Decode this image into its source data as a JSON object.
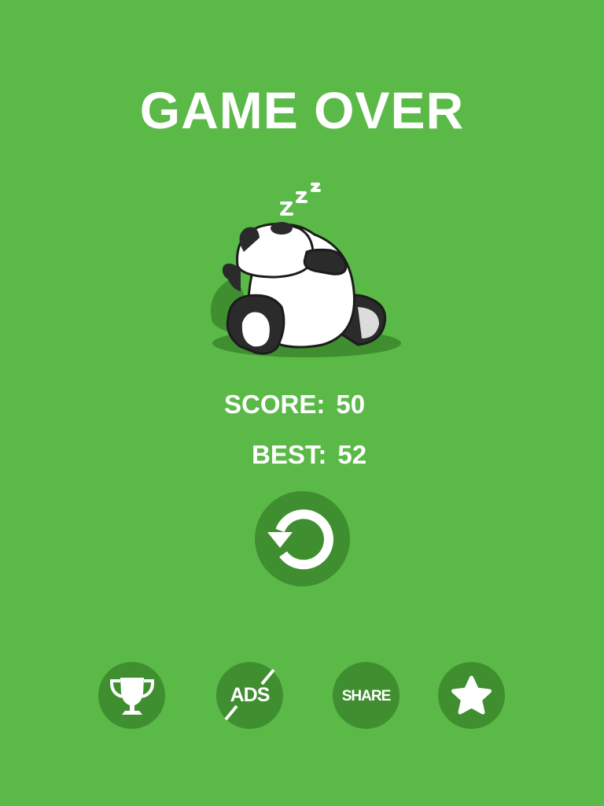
{
  "screen": {
    "title": "GAME OVER",
    "background_color": "#5ab947",
    "button_color": "#3f8e30"
  },
  "sleep_text": "Z Z Z",
  "stats": {
    "score_label": "SCORE:",
    "score_value": "50",
    "best_label": "BEST:",
    "best_value": "52"
  },
  "replay": {
    "icon": "replay-arrow-icon"
  },
  "bottom_buttons": [
    {
      "icon": "trophy-icon",
      "label": ""
    },
    {
      "icon": "no-ads-icon",
      "label": "ADS"
    },
    {
      "icon": "share-icon",
      "label": "SHARE"
    },
    {
      "icon": "star-icon",
      "label": ""
    }
  ]
}
